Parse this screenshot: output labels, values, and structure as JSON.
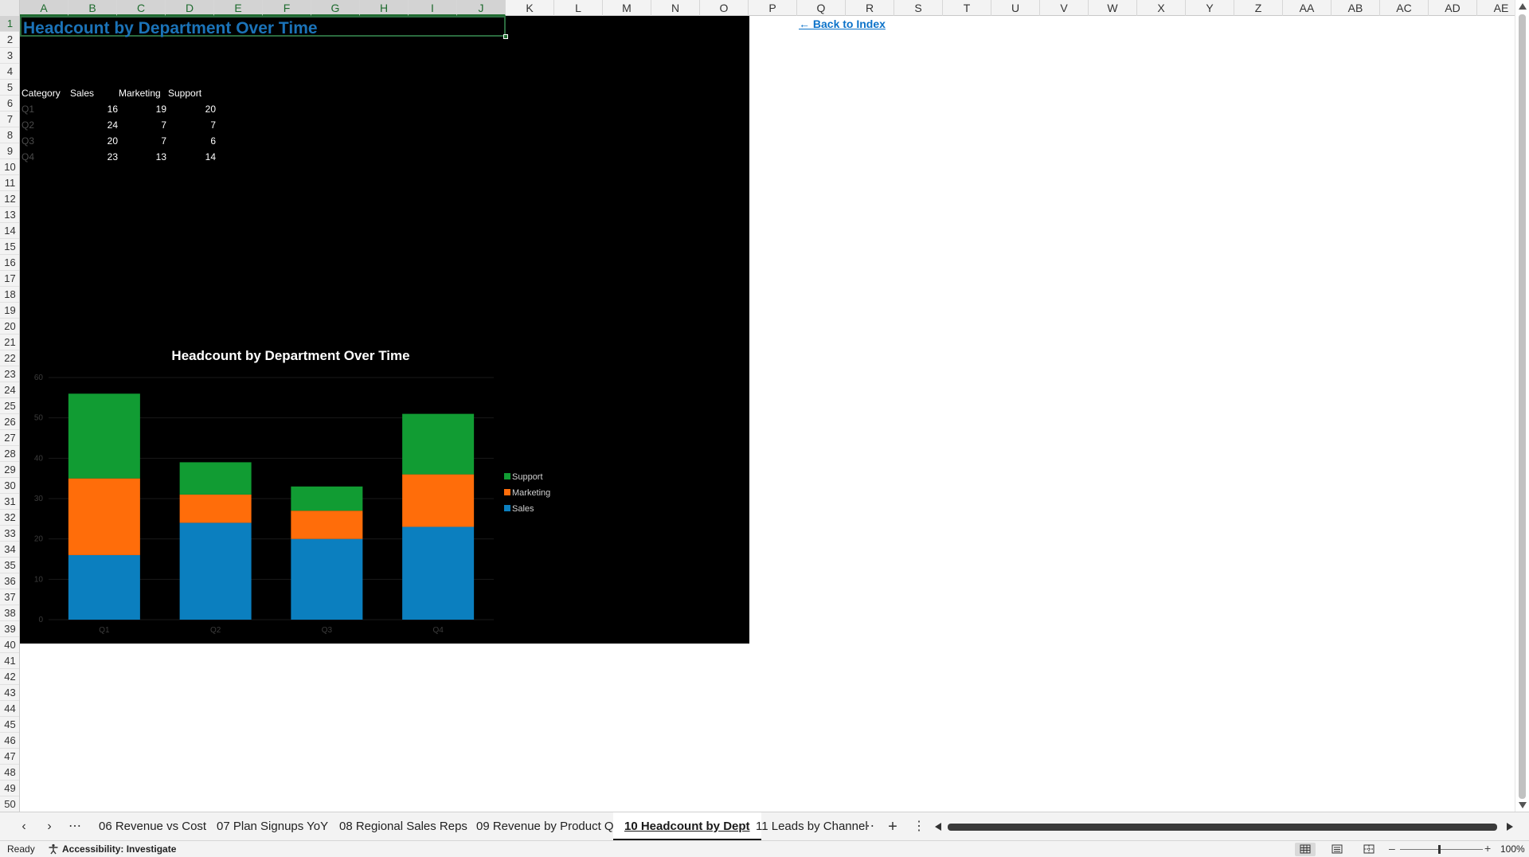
{
  "sheet": {
    "columns": [
      "A",
      "B",
      "C",
      "D",
      "E",
      "F",
      "G",
      "H",
      "I",
      "J",
      "K",
      "L",
      "M",
      "N",
      "O",
      "P",
      "Q",
      "R",
      "S",
      "T",
      "U",
      "V",
      "W",
      "X",
      "Y",
      "Z",
      "AA",
      "AB",
      "AC",
      "AD",
      "AE"
    ],
    "rows": [
      "1",
      "2",
      "3",
      "4",
      "5",
      "6",
      "7",
      "8",
      "9",
      "10",
      "11",
      "12",
      "13",
      "14",
      "15",
      "16",
      "17",
      "18",
      "19",
      "20",
      "21",
      "22",
      "23",
      "24",
      "25",
      "26",
      "27",
      "28",
      "29",
      "30",
      "31",
      "32",
      "33",
      "34",
      "35",
      "36",
      "37",
      "38",
      "39",
      "40",
      "41",
      "42",
      "43",
      "44",
      "45",
      "46",
      "47",
      "48",
      "49",
      "50"
    ],
    "title": "Headcount by Department Over Time",
    "back_link": "← Back to Index",
    "table": {
      "headers": [
        "Category",
        "Sales",
        "Marketing",
        "Support"
      ],
      "rows": [
        {
          "cat": "Q1",
          "sales": "16",
          "marketing": "19",
          "support": "20"
        },
        {
          "cat": "Q2",
          "sales": "24",
          "marketing": "7",
          "support": "7"
        },
        {
          "cat": "Q3",
          "sales": "20",
          "marketing": "7",
          "support": "6"
        },
        {
          "cat": "Q4",
          "sales": "23",
          "marketing": "13",
          "support": "14"
        }
      ]
    }
  },
  "chart_data": {
    "type": "bar",
    "stacked": true,
    "title": "Headcount by Department Over Time",
    "categories": [
      "Q1",
      "Q2",
      "Q3",
      "Q4"
    ],
    "series": [
      {
        "name": "Sales",
        "values": [
          16,
          24,
          20,
          23
        ],
        "color": "#0b7fbf"
      },
      {
        "name": "Marketing",
        "values": [
          19,
          7,
          7,
          13
        ],
        "color": "#ff6d0a"
      },
      {
        "name": "Support",
        "values": [
          21,
          8,
          6,
          15
        ],
        "color": "#119c33"
      }
    ],
    "yticks": [
      "0",
      "10",
      "20",
      "30",
      "40",
      "50",
      "60"
    ],
    "ylim": [
      0,
      60
    ],
    "legend_position": "right",
    "background": "#000000"
  },
  "tabs": {
    "items": [
      {
        "label": "06 Revenue vs Cost"
      },
      {
        "label": "07 Plan Signups YoY"
      },
      {
        "label": "08 Regional Sales Reps"
      },
      {
        "label": "09 Revenue by Product Q"
      },
      {
        "label": "10 Headcount by Dept",
        "active": true
      },
      {
        "label": "11 Leads by Channel"
      }
    ],
    "more": "⋯",
    "add": "+",
    "menu": "⋮"
  },
  "status": {
    "ready": "Ready",
    "accessibility": "Accessibility: Investigate",
    "zoom": "100%"
  }
}
